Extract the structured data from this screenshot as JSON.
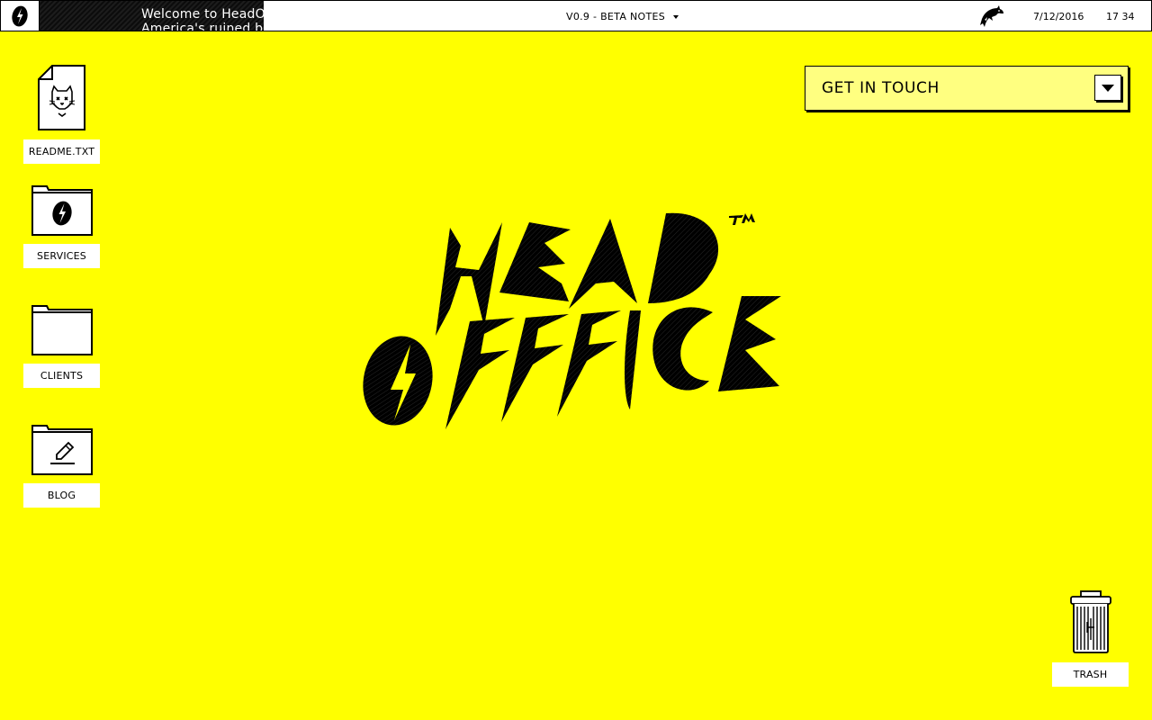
{
  "menubar": {
    "logo_icon": "bolt-coffee-bean-icon",
    "ticker_text": "Welcome to HeadO\nAmerica's ruined b",
    "version_label": "V0.9 - BETA NOTES",
    "dolphin_icon": "dolphin-icon",
    "date": "7/12/2016",
    "time": "17 34"
  },
  "desktop": {
    "icons": [
      {
        "label": "README.TXT",
        "icon": "cat-document-icon"
      },
      {
        "label": "SERVICES",
        "icon": "bolt-folder-icon"
      },
      {
        "label": "CLIENTS",
        "icon": "folder-icon"
      },
      {
        "label": "BLOG",
        "icon": "pencil-folder-icon"
      }
    ],
    "trash": {
      "label": "TRASH",
      "icon": "trash-can-icon"
    }
  },
  "contact": {
    "label": "GET IN TOUCH",
    "toggle_icon": "caret-down-icon"
  },
  "brand": {
    "line1": "HEAD",
    "line2": "OFFICE",
    "tm": "TM",
    "background": "#ffff00",
    "accent": "#000000"
  }
}
